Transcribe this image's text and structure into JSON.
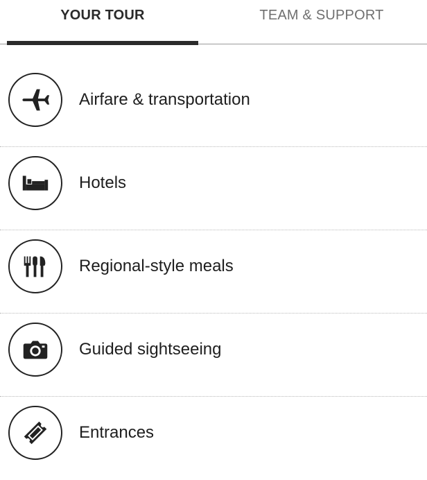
{
  "tabs": {
    "your_tour": "YOUR TOUR",
    "team_support": "TEAM & SUPPORT"
  },
  "list": {
    "items": [
      {
        "label": "Airfare & transportation",
        "icon": "airplane-icon"
      },
      {
        "label": "Hotels",
        "icon": "bed-icon"
      },
      {
        "label": "Regional-style meals",
        "icon": "utensils-icon"
      },
      {
        "label": "Guided sightseeing",
        "icon": "camera-icon"
      },
      {
        "label": "Entrances",
        "icon": "ticket-icon"
      }
    ]
  }
}
